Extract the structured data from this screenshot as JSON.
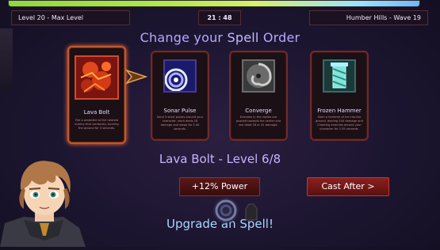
{
  "hud": {
    "left": "Level 20 - Max Level",
    "timer": "21 : 48",
    "right": "Humber Hills - Wave 19"
  },
  "title": {
    "part1": "Change your",
    "part2": "Spell",
    "part3": "Order"
  },
  "cards": [
    {
      "name": "Lava Bolt",
      "desc": "Fire a projectile at the nearest enemy that combusts, burning the ground for 4 seconds."
    },
    {
      "name": "Sonar Pulse",
      "desc": "Send 3 short pulses around your character, each deals 18 damage and slows for 2.40 seconds."
    },
    {
      "name": "Converge",
      "desc": "Enemies in the vortex are pushed towards the center and are dealt 18 or 41 damage."
    },
    {
      "name": "Frozen Hammer",
      "desc": "Slam a hammer of ice into the ground, dealing 100 damage and Chanting enemies around your character for 1.05 seconds."
    }
  ],
  "level_text": "Lava Bolt - Level 6/8",
  "buttons": {
    "power": "+12% Power",
    "cast": "Cast After >"
  },
  "upgrade_text": "Upgrade an Spell!",
  "colors": {
    "accent": "#b9a7ff",
    "card_border": "#6e2b2b",
    "button_red": "#8a2020"
  }
}
